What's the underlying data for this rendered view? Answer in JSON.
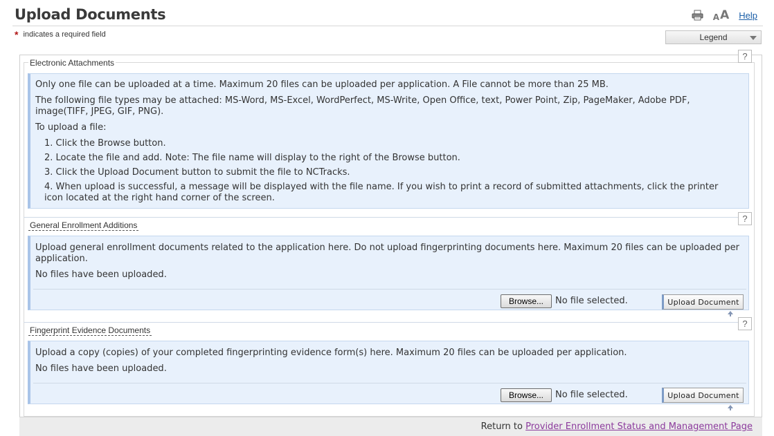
{
  "header": {
    "title": "Upload Documents",
    "help_label": "Help",
    "font_small": "A",
    "font_large": "A"
  },
  "required_note": {
    "star": "*",
    "text": "indicates a required field"
  },
  "legend_select": {
    "label": "Legend"
  },
  "help_icon_label": "?",
  "sections": {
    "electronic": {
      "title": "Electronic Attachments",
      "line1": "Only one file can be uploaded at a time. Maximum 20 files can be uploaded per application. A File cannot be more than 25 MB.",
      "line2": "The following file types may be attached: MS-Word, MS-Excel, WordPerfect, MS-Write, Open Office, text, Power Point, Zip, PageMaker, Adobe PDF, image(TIFF, JPEG, GIF, PNG).",
      "line3": "To upload a file:",
      "steps": [
        "1. Click the Browse button.",
        "2. Locate the file and add. Note: The file name will display to the right of the Browse button.",
        "3. Click the Upload Document button to submit the file to NCTracks.",
        "4. When upload is successful, a message will be displayed with the file name. If you wish to print a record of submitted attachments, click the printer icon located at the right hand corner of the screen."
      ]
    },
    "general": {
      "title": "General Enrollment Additions",
      "description": "Upload general enrollment documents related to the application here. Do not upload fingerprinting documents here. Maximum 20 files can be uploaded per application.",
      "status": "No files have been uploaded.",
      "browse_label": "Browse...",
      "file_status": "No file selected.",
      "upload_label": "Upload Document"
    },
    "fingerprint": {
      "title": "Fingerprint Evidence Documents",
      "description": "Upload a copy (copies) of your completed fingerprinting evidence form(s) here. Maximum 20 files can be uploaded per application.",
      "status": "No files have been uploaded.",
      "browse_label": "Browse...",
      "file_status": "No file selected.",
      "upload_label": "Upload Document"
    }
  },
  "footer": {
    "prefix": "Return to ",
    "link_label": "Provider Enrollment Status and Management Page"
  },
  "icons": {
    "printer": "printer-icon",
    "help": "question-mark-icon",
    "arrow_up": "arrow-up-icon",
    "caret": "chevron-down-icon"
  }
}
